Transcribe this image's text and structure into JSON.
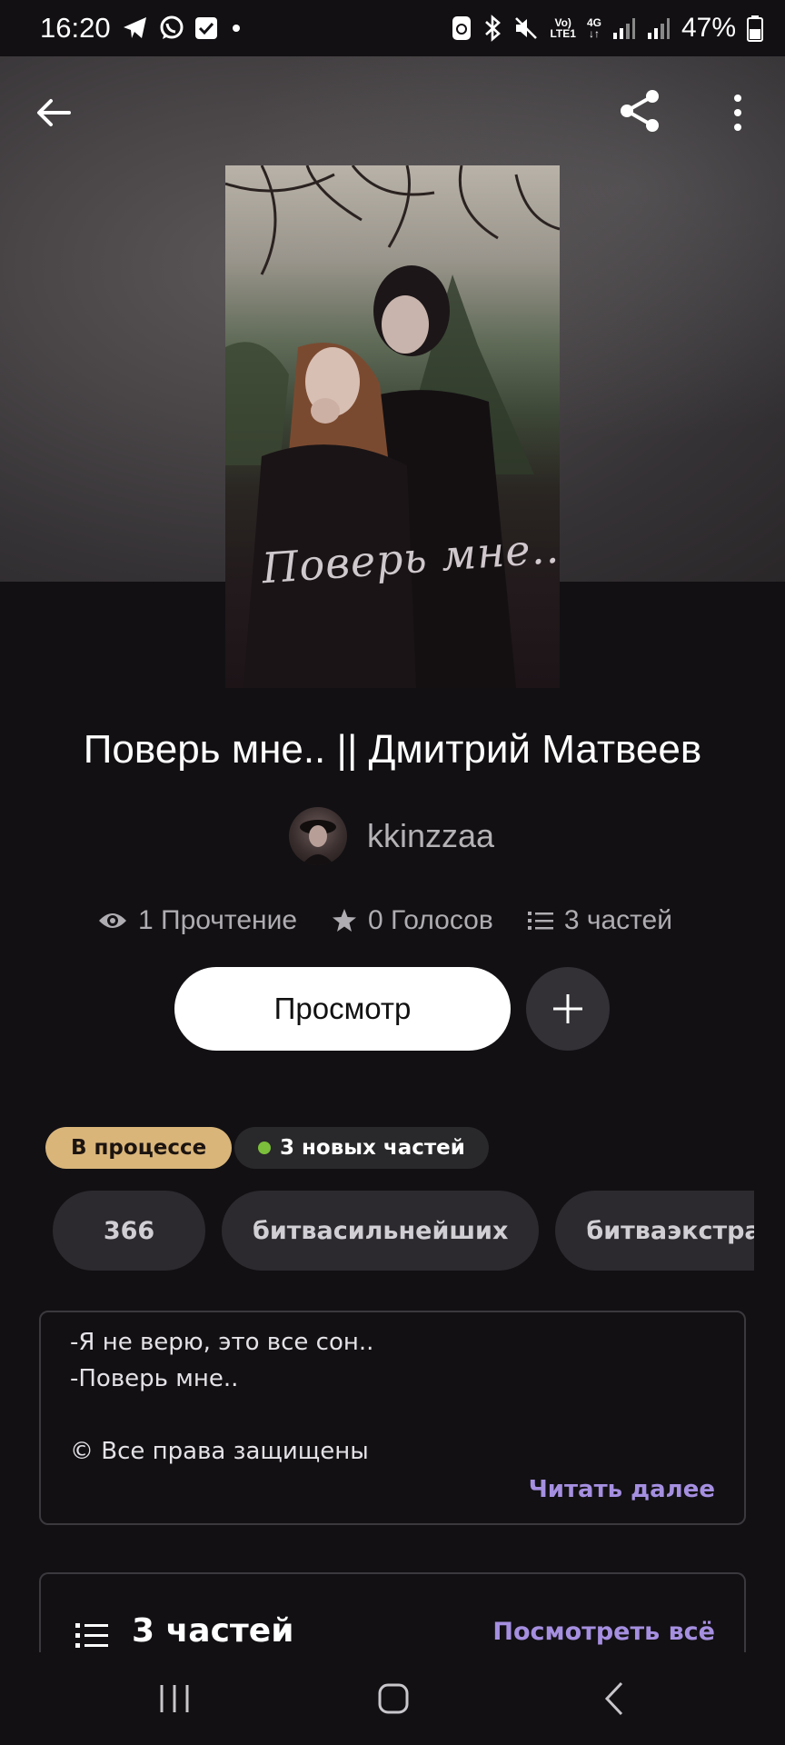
{
  "status_bar": {
    "time": "16:20",
    "battery": "47%",
    "volte_label": "Vo)",
    "lte_label": "LTE1",
    "network_label": "4G",
    "icons": [
      "telegram-icon",
      "whatsapp-icon",
      "tasks-icon",
      "dot-icon",
      "sync-icon",
      "bluetooth-icon",
      "mute-icon",
      "volte-icon",
      "4g-icon",
      "signal-icon",
      "signal-icon",
      "battery-icon"
    ]
  },
  "header": {
    "back_icon": "arrow-left-icon",
    "share_icon": "share-icon",
    "more_icon": "more-vertical-icon"
  },
  "story": {
    "cover_text": "Поверь мне..",
    "title": "Поверь мне.. || Дмитрий Матвеев",
    "author": "kkinzzaa",
    "stats": {
      "reads": "1 Прочтение",
      "votes": "0 Голосов",
      "parts": "3 частей"
    },
    "read_button": "Просмотр",
    "status_badge": "В процессе",
    "new_parts_badge": "3 новых частей",
    "tags": [
      "366",
      "битвасильнейших",
      "битваэкстрасе"
    ],
    "description_lines": [
      "-Я не верю, это все сон..",
      "-Поверь мне..",
      "",
      "© Все права защищены"
    ],
    "read_more": "Читать далее"
  },
  "parts_section": {
    "title": "3 частей",
    "see_all": "Посмотреть всё"
  },
  "colors": {
    "background": "#121013",
    "accent_purple": "#a58fe0",
    "badge_gold": "#d9b57a",
    "new_dot_green": "#7bbf3a"
  }
}
